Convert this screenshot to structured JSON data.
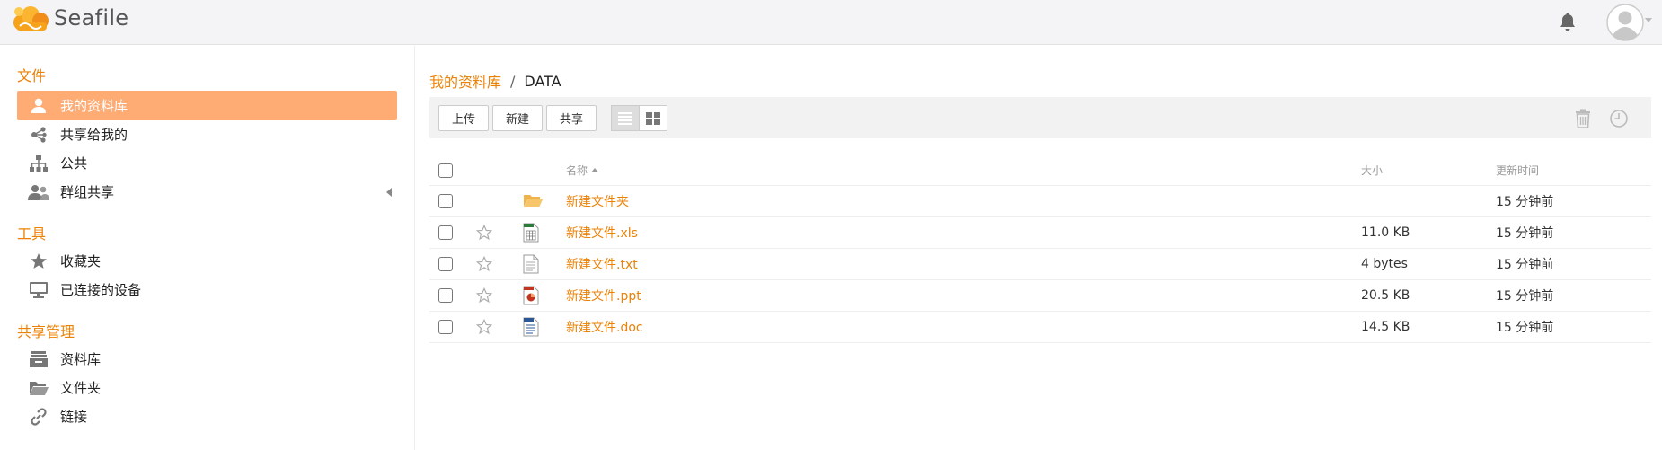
{
  "header": {
    "logo_text": "Seafile",
    "icons": {
      "notifications": "bell-icon",
      "account": "avatar-icon"
    }
  },
  "sidebar": {
    "sections": [
      {
        "title": "文件",
        "items": [
          {
            "label": "我的资料库",
            "icon": "user-icon",
            "active": true
          },
          {
            "label": "共享给我的",
            "icon": "share-icon"
          },
          {
            "label": "公共",
            "icon": "org-chart-icon"
          },
          {
            "label": "群组共享",
            "icon": "group-icon",
            "expandable": true
          }
        ]
      },
      {
        "title": "工具",
        "items": [
          {
            "label": "收藏夹",
            "icon": "star-icon"
          },
          {
            "label": "已连接的设备",
            "icon": "monitor-icon"
          }
        ]
      },
      {
        "title": "共享管理",
        "items": [
          {
            "label": "资料库",
            "icon": "library-icon"
          },
          {
            "label": "文件夹",
            "icon": "folder-open-icon"
          },
          {
            "label": "链接",
            "icon": "link-icon"
          }
        ]
      }
    ]
  },
  "breadcrumb": {
    "root": "我的资料库",
    "separator": "/",
    "current": "DATA"
  },
  "toolbar": {
    "upload": "上传",
    "new": "新建",
    "share": "共享",
    "views": [
      "list-view-icon",
      "grid-view-icon"
    ],
    "right_icons": [
      "trash-icon",
      "history-icon"
    ]
  },
  "table": {
    "columns": {
      "name": "名称",
      "size": "大小",
      "updated": "更新时间"
    },
    "rows": [
      {
        "name": "新建文件夹",
        "type": "folder",
        "size": "",
        "updated": "15 分钟前"
      },
      {
        "name": "新建文件.xls",
        "type": "xls",
        "size": "11.0 KB",
        "updated": "15 分钟前"
      },
      {
        "name": "新建文件.txt",
        "type": "txt",
        "size": "4 bytes",
        "updated": "15 分钟前"
      },
      {
        "name": "新建文件.ppt",
        "type": "ppt",
        "size": "20.5 KB",
        "updated": "15 分钟前"
      },
      {
        "name": "新建文件.doc",
        "type": "doc",
        "size": "14.5 KB",
        "updated": "15 分钟前"
      }
    ]
  },
  "colors": {
    "accent": "#eb8205",
    "active_bg": "#feac74"
  }
}
